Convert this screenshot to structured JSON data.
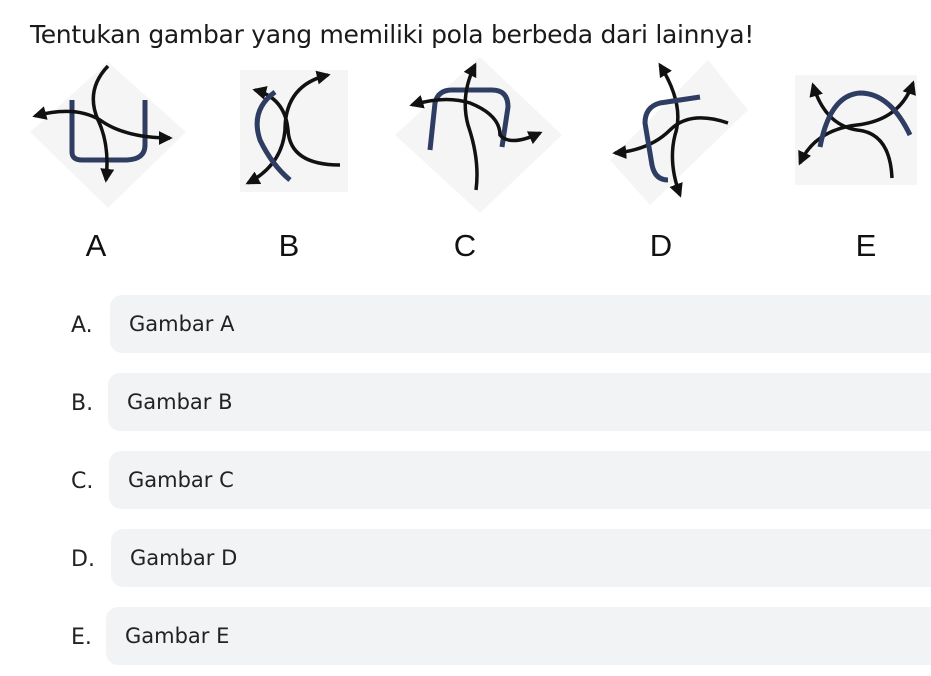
{
  "question": "Tentukan gambar yang memiliki pola berbeda dari lainnya!",
  "figures": [
    {
      "label": "A",
      "icon": "crossed-arrows-figure-a"
    },
    {
      "label": "B",
      "icon": "crossed-arrows-figure-b"
    },
    {
      "label": "C",
      "icon": "crossed-arrows-figure-c"
    },
    {
      "label": "D",
      "icon": "crossed-arrows-figure-d"
    },
    {
      "label": "E",
      "icon": "crossed-arrows-figure-e"
    }
  ],
  "options": [
    {
      "letter": "A.",
      "text": "Gambar A"
    },
    {
      "letter": "B.",
      "text": "Gambar B"
    },
    {
      "letter": "C.",
      "text": "Gambar C"
    },
    {
      "letter": "D.",
      "text": "Gambar D"
    },
    {
      "letter": "E.",
      "text": "Gambar E"
    }
  ],
  "colors": {
    "blue_curve": "#2f3d63",
    "black_curve": "#111111",
    "option_bg": "#f2f3f5"
  }
}
